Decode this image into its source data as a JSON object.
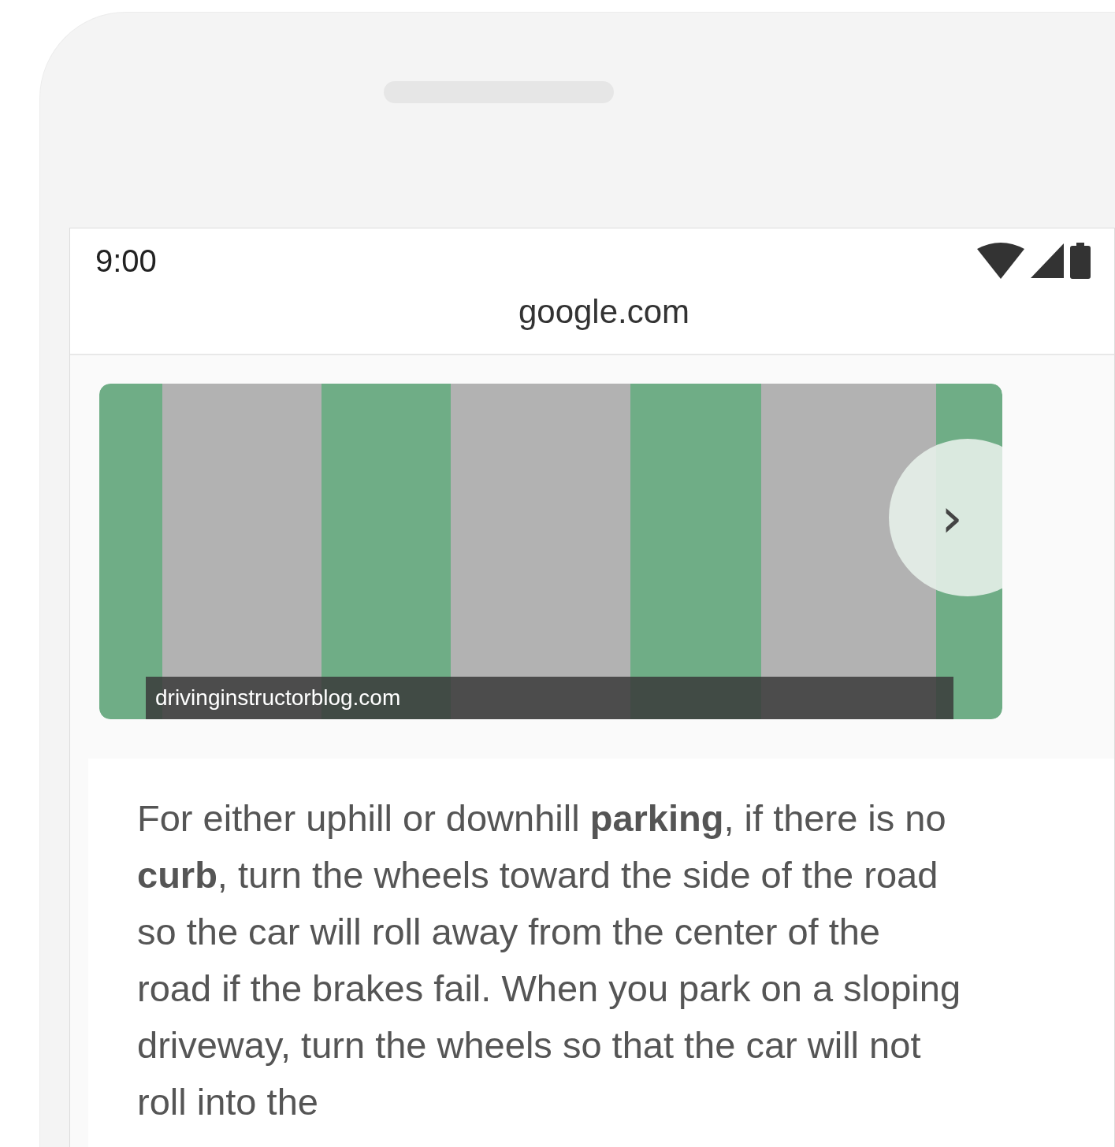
{
  "status_bar": {
    "time": "9:00"
  },
  "address_bar": {
    "url": "google.com"
  },
  "image_result": {
    "source": "drivinginstructorblog.com",
    "next_label": "›"
  },
  "snippet": {
    "text": "For either uphill or downhill **parking**, if there is no **curb**, turn the wheels toward the side of the road so the car will roll away from the center of the road if the brakes fail. When you park on a sloping driveway, turn the wheels so that the car will not roll into the"
  }
}
